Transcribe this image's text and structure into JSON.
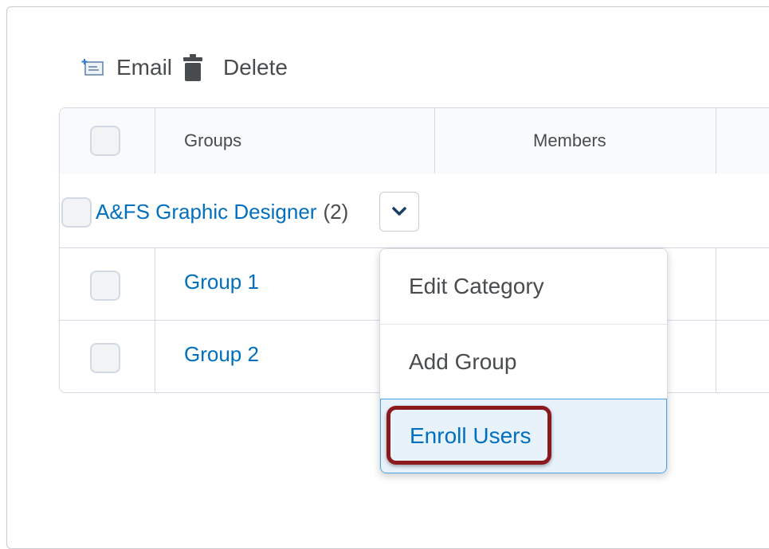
{
  "toolbar": {
    "email_label": "Email",
    "delete_label": "Delete",
    "email_icon": "email-icon",
    "delete_icon": "trash-icon"
  },
  "table": {
    "columns": [
      "Groups",
      "Members"
    ],
    "category": {
      "name": "A&FS Graphic Designer",
      "count": "(2)"
    },
    "rows": [
      {
        "name": "Group 1"
      },
      {
        "name": "Group 2"
      }
    ]
  },
  "context_menu": {
    "items": [
      "Edit Category",
      "Add Group",
      "Enroll Users"
    ],
    "active_index": 2
  },
  "colors": {
    "link": "#006fbf",
    "text": "#494c4e",
    "highlight": "#8b1a1f",
    "active_bg": "#e8f2fb"
  }
}
